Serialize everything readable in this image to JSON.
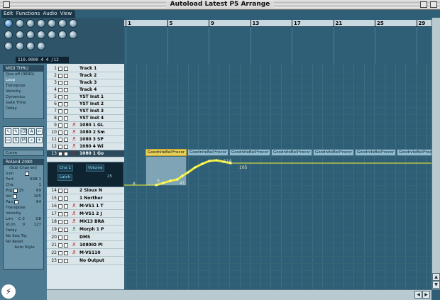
{
  "window": {
    "title": "Autoload Latest P5 Arrange"
  },
  "menu": [
    "Edit",
    "Functions",
    "Audio",
    "View"
  ],
  "transport": {
    "position": "110.0000  4  4  /12"
  },
  "ruler": {
    "labels": [
      "1",
      "5",
      "9",
      "13",
      "17",
      "21",
      "25",
      "29"
    ]
  },
  "inspector": {
    "midi_thru": "MIDI THRU",
    "qua_label": "Qua",
    "qua_value": "off (3840)",
    "params": [
      "Loop",
      "Transpose",
      "Velocity",
      "Dynamics",
      "Gate Time",
      "Delay"
    ],
    "curve": "Curve",
    "device_name": "Roland 2080",
    "device_sub": "(Sub Channel)",
    "icon_label": "Icon",
    "port_label": "Port",
    "port_value": "USB 1",
    "cha_label": "Cha",
    "cha_value": "1",
    "prg_label": "Prg",
    "prg_value1": "15",
    "prg_value2": "69",
    "vol_label": "Vol",
    "vol_value": "105",
    "pan_label": "Pan",
    "pan_value": "64",
    "transpose": "Transpose",
    "velocity": "Velocity",
    "lim_label": "Lim",
    "lim_low": "C-2",
    "lim_high": "G8",
    "vlim_label": "VLim",
    "vlim_low": "0",
    "vlim_high": "127",
    "delay": "Delay",
    "no_seq_trp": "No Seq Trp",
    "no_reset": "No Reset",
    "auto_style": "Auto Style"
  },
  "tracks": [
    {
      "num": "1",
      "name": "Track 1",
      "icon": ""
    },
    {
      "num": "2",
      "name": "Track 2",
      "icon": ""
    },
    {
      "num": "3",
      "name": "Track 3",
      "icon": ""
    },
    {
      "num": "4",
      "name": "Track 4",
      "icon": ""
    },
    {
      "num": "5",
      "name": "YST Inst 1",
      "icon": ""
    },
    {
      "num": "6",
      "name": "YST Inst 2",
      "icon": ""
    },
    {
      "num": "7",
      "name": "YST Inst 3",
      "icon": ""
    },
    {
      "num": "8",
      "name": "YST Inst 4",
      "icon": ""
    },
    {
      "num": "9",
      "name": "1080 1 GL",
      "icon": ""
    },
    {
      "num": "10",
      "name": "1080 2 Sm",
      "icon": ""
    },
    {
      "num": "11",
      "name": "1080 3 SP",
      "icon": ""
    },
    {
      "num": "12",
      "name": "1080 4 Wi",
      "icon": ""
    },
    {
      "num": "13",
      "name": "1080 1 Go",
      "icon": ""
    },
    {
      "num": "14",
      "name": "2 Sioux N",
      "icon": ""
    },
    {
      "num": "15",
      "name": "1 Norther",
      "icon": ""
    },
    {
      "num": "16",
      "name": "M-VS1 1 T",
      "icon": ""
    },
    {
      "num": "17",
      "name": "M-VS1 2 J",
      "icon": ""
    },
    {
      "num": "18",
      "name": "MX13 BRA",
      "icon": ""
    },
    {
      "num": "19",
      "name": "Morph 1 P",
      "icon": ""
    },
    {
      "num": "20",
      "name": "DMS",
      "icon": ""
    },
    {
      "num": "21",
      "name": "1080IO PI",
      "icon": ""
    },
    {
      "num": "22",
      "name": "M-VS110",
      "icon": ""
    },
    {
      "num": "23",
      "name": "No Output",
      "icon": ""
    }
  ],
  "lane": {
    "cha": "Cha 1",
    "param": "Volume",
    "mode": "Latch",
    "value": "25"
  },
  "parts": [
    {
      "label": "GoodniteBell*recor",
      "selected": true
    },
    {
      "label": "GoodniteBell*recor",
      "selected": false
    },
    {
      "label": "GoodniteBell*recor",
      "selected": false
    },
    {
      "label": "GoodniteBell*recor",
      "selected": false
    },
    {
      "label": "GoodniteBell*recor",
      "selected": false
    },
    {
      "label": "GoodniteBell*recor",
      "selected": false
    },
    {
      "label": "GoodniteBell*recor",
      "selected": false
    }
  ],
  "automation": {
    "values": [
      "8",
      "9",
      "41",
      "114",
      "105"
    ]
  },
  "colors": {
    "background": "#2f5f76",
    "automation_line": "#f2ef31",
    "selected_part": "#e7d05b"
  }
}
